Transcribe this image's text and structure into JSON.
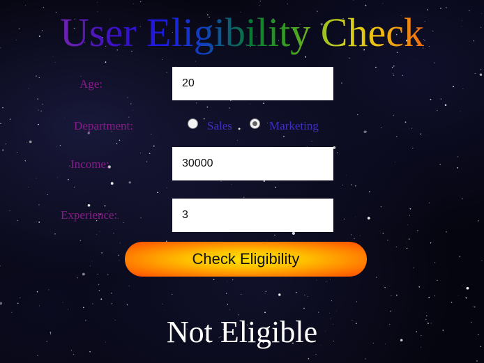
{
  "title": "User Eligibility Check",
  "form": {
    "age": {
      "label": "Age:",
      "value": "20"
    },
    "department": {
      "label": "Department:",
      "options": [
        {
          "label": "Sales",
          "checked": false
        },
        {
          "label": "Marketing",
          "checked": true
        }
      ]
    },
    "income": {
      "label": "Income:",
      "value": "30000"
    },
    "experience": {
      "label": "Experience:",
      "value": "3"
    }
  },
  "button": {
    "label": "Check Eligibility"
  },
  "result": "Not Eligible"
}
